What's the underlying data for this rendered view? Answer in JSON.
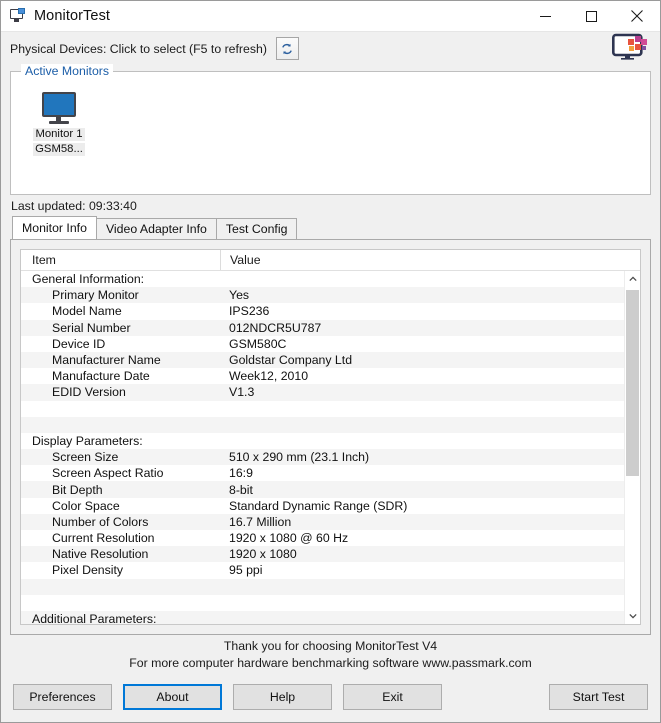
{
  "window": {
    "title": "MonitorTest",
    "icon": "monitor-app-icon",
    "controls": {
      "minimize": "minimize-icon",
      "maximize": "maximize-icon",
      "close": "close-icon"
    }
  },
  "toolbar": {
    "label": "Physical Devices: Click to select (F5 to refresh)",
    "refresh_icon": "refresh-icon",
    "brand_icon": "monitor-colors-logo"
  },
  "active_monitors": {
    "title": "Active Monitors",
    "devices": [
      {
        "icon": "monitor-icon",
        "line1": "Monitor  1",
        "line2": "GSM58..."
      }
    ]
  },
  "status": {
    "last_updated": "Last updated: 09:33:40"
  },
  "tabs": [
    {
      "label": "Monitor Info",
      "active": true
    },
    {
      "label": "Video Adapter Info",
      "active": false
    },
    {
      "label": "Test Config",
      "active": false
    }
  ],
  "table": {
    "columns": [
      "Item",
      "Value"
    ],
    "rows": [
      {
        "type": "section",
        "item": "General Information:",
        "value": ""
      },
      {
        "type": "data",
        "item": "Primary Monitor",
        "value": "Yes"
      },
      {
        "type": "data",
        "item": "Model Name",
        "value": "IPS236"
      },
      {
        "type": "data",
        "item": "Serial Number",
        "value": "012NDCR5U787"
      },
      {
        "type": "data",
        "item": "Device ID",
        "value": "GSM580C"
      },
      {
        "type": "data",
        "item": "Manufacturer Name",
        "value": "Goldstar Company Ltd"
      },
      {
        "type": "data",
        "item": "Manufacture Date",
        "value": "Week12, 2010"
      },
      {
        "type": "data",
        "item": "EDID Version",
        "value": "V1.3"
      },
      {
        "type": "spacer",
        "item": "",
        "value": ""
      },
      {
        "type": "spacer",
        "item": "",
        "value": ""
      },
      {
        "type": "section",
        "item": "Display Parameters:",
        "value": ""
      },
      {
        "type": "data",
        "item": "Screen Size",
        "value": "510 x 290 mm (23.1 Inch)"
      },
      {
        "type": "data",
        "item": "Screen Aspect Ratio",
        "value": "16:9"
      },
      {
        "type": "data",
        "item": "Bit Depth",
        "value": "8-bit"
      },
      {
        "type": "data",
        "item": "Color Space",
        "value": "Standard Dynamic Range (SDR)"
      },
      {
        "type": "data",
        "item": "Number of Colors",
        "value": "16.7 Million"
      },
      {
        "type": "data",
        "item": "Current Resolution",
        "value": "1920 x 1080 @ 60 Hz"
      },
      {
        "type": "data",
        "item": "Native Resolution",
        "value": "1920 x 1080"
      },
      {
        "type": "data",
        "item": "Pixel Density",
        "value": "95 ppi"
      },
      {
        "type": "spacer",
        "item": "",
        "value": ""
      },
      {
        "type": "spacer",
        "item": "",
        "value": ""
      },
      {
        "type": "section",
        "item": "Additional Parameters:",
        "value": ""
      }
    ],
    "scrollbar": {
      "up_icon": "chevron-up-icon",
      "down_icon": "chevron-down-icon",
      "thumb_percent": 58
    }
  },
  "footer": {
    "line1": "Thank you for choosing MonitorTest V4",
    "line2": "For more computer hardware benchmarking software www.passmark.com"
  },
  "buttons": {
    "preferences": "Preferences",
    "about": "About",
    "help": "Help",
    "exit": "Exit",
    "start_test": "Start Test"
  },
  "colors": {
    "accent": "#0078d7",
    "group_title": "#1c5ea8",
    "monitor_blue": "#2176bd",
    "window_bg": "#f0f0f0"
  }
}
